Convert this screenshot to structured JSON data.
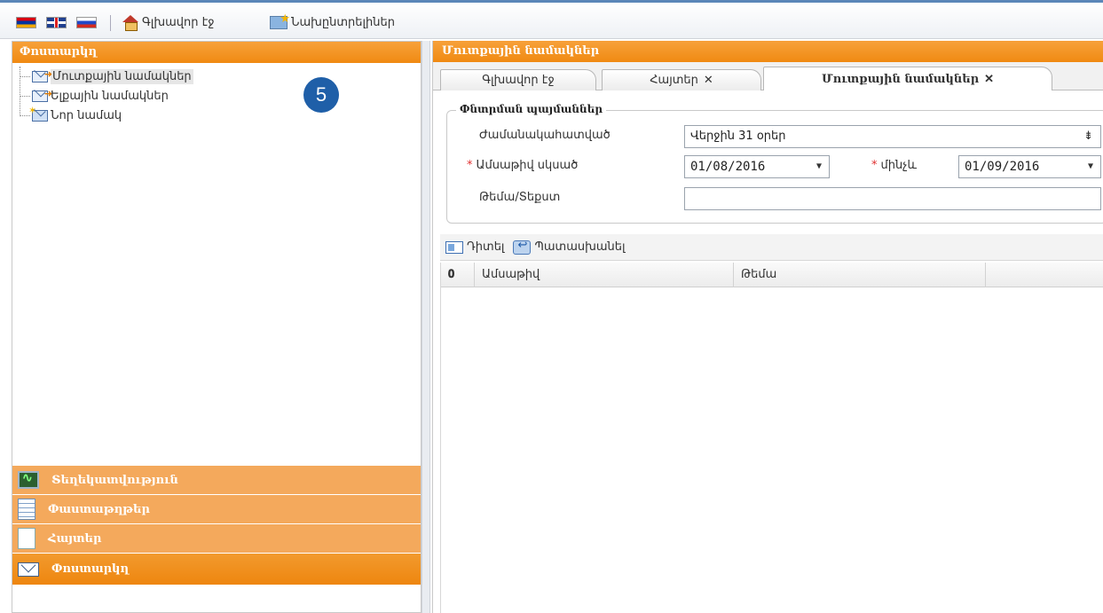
{
  "toolbar": {
    "languages": [
      "am-flag",
      "gb-flag",
      "ru-flag"
    ],
    "home_label": "Գլխավոր էջ",
    "prefs_label": "Նախընտրելիներ"
  },
  "left_panel": {
    "title": "Փոստարկղ",
    "tree": [
      {
        "label": "Մուտքային նամակներ",
        "icon": "inbox-envelope-icon",
        "selected": true
      },
      {
        "label": "Ելքային նամակներ",
        "icon": "outbox-envelope-icon",
        "selected": false
      },
      {
        "label": "Նոր նամակ",
        "icon": "new-letter-icon",
        "selected": false
      }
    ],
    "badge": "5",
    "accordion": [
      {
        "label": "Տեղեկատվություն",
        "icon": "monitor-icon",
        "active": false
      },
      {
        "label": "Փաստաթղթեր",
        "icon": "document-list-icon",
        "active": false
      },
      {
        "label": "Հայտեր",
        "icon": "document-icon",
        "active": false
      },
      {
        "label": "Փոստարկղ",
        "icon": "mail-icon",
        "active": true
      }
    ]
  },
  "right_panel": {
    "title": "Մուտքային նամակներ",
    "tabs": [
      {
        "label": "Գլխավոր էջ",
        "closable": false,
        "active": false
      },
      {
        "label": "Հայտեր",
        "closable": true,
        "active": false
      },
      {
        "label": "Մուտքային նամակներ",
        "closable": true,
        "active": true
      }
    ],
    "close_glyph": "✕",
    "filter": {
      "legend": "Փնտրման պայմաններ",
      "period_label": "Ժամանակահատված",
      "period_value": "Վերջին 31 օրեր",
      "date_from_label": "Ամսաթիվ սկսած",
      "date_from_value": "01/08/2016",
      "date_to_label": "մինչև",
      "date_to_value": "01/09/2016",
      "subject_label": "Թեմա/Տեքստ",
      "subject_value": "",
      "required_mark": "*"
    },
    "grid_toolbar": {
      "view_label": "Դիտել",
      "reply_label": "Պատասխանել"
    },
    "grid": {
      "columns": [
        "",
        "Ամսաթիվ",
        "Թեմա",
        ""
      ],
      "attachment_glyph": "𝟎"
    }
  },
  "colors": {
    "orange": "#f08a12",
    "orange_light": "#f4a95c",
    "badge_blue": "#1f5fa8",
    "required_red": "#e03030"
  }
}
